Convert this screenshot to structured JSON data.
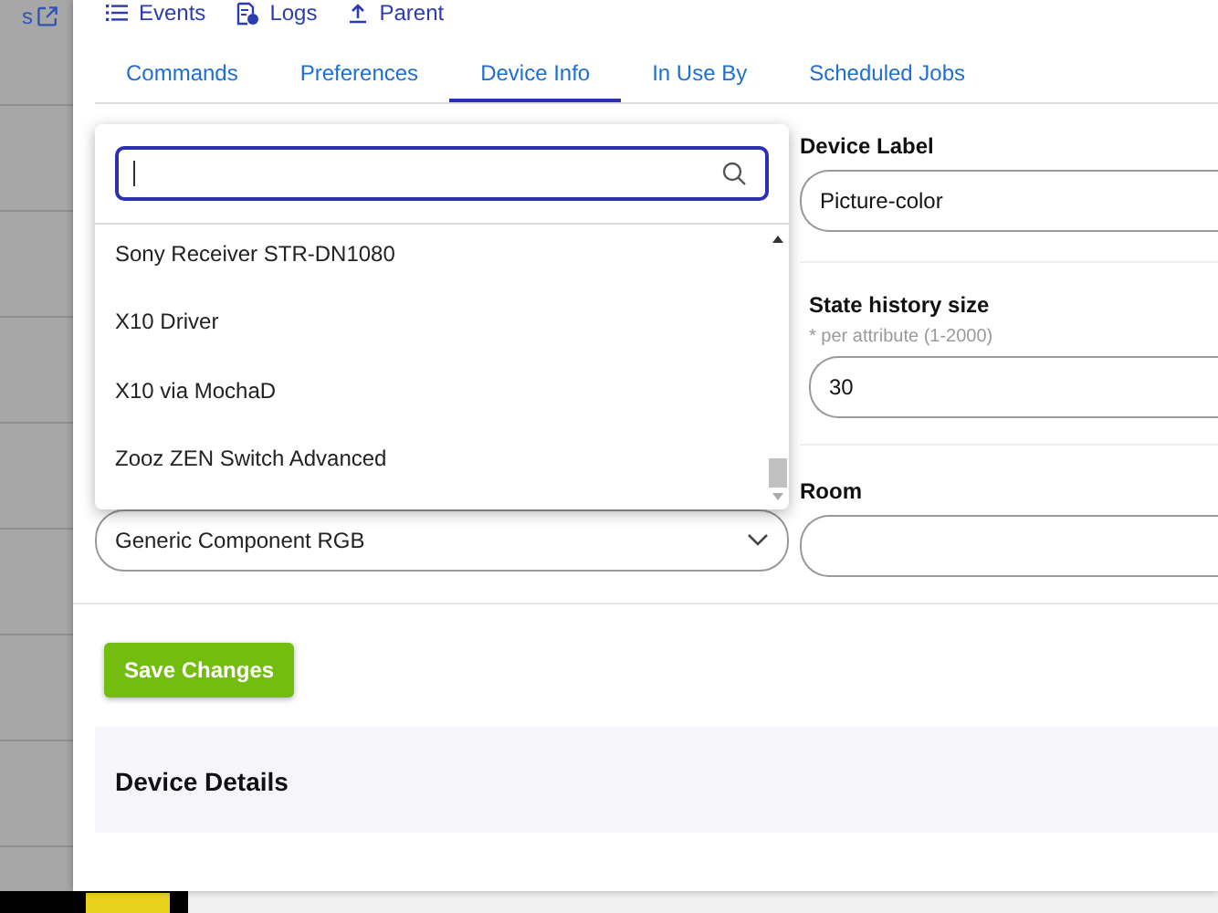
{
  "background": {
    "side_text": "s"
  },
  "top_links": [
    {
      "label": "Events"
    },
    {
      "label": "Logs"
    },
    {
      "label": "Parent"
    }
  ],
  "tabs": [
    {
      "label": "Commands",
      "selected": false
    },
    {
      "label": "Preferences",
      "selected": false
    },
    {
      "label": "Device Info",
      "selected": true
    },
    {
      "label": "In Use By",
      "selected": false
    },
    {
      "label": "Scheduled Jobs",
      "selected": false
    }
  ],
  "form": {
    "driver": {
      "value": "Generic Component RGB"
    },
    "device_label": {
      "label": "Device Label",
      "value": "Picture-color"
    },
    "state_history": {
      "label": "State history size",
      "hint": "* per attribute (1-2000)",
      "value": "30"
    },
    "room": {
      "label": "Room"
    }
  },
  "dropdown": {
    "items": [
      {
        "label": "Sony Receiver STR-DN1080"
      },
      {
        "label": "X10 Driver"
      },
      {
        "label": "X10 via MochaD"
      },
      {
        "label": "Zooz ZEN Switch Advanced"
      }
    ]
  },
  "save_button": "Save Changes",
  "details": {
    "title": "Device Details"
  }
}
